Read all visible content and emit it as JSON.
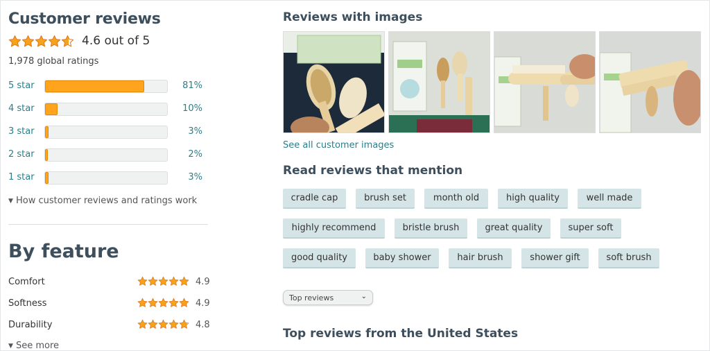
{
  "customer_reviews": {
    "title": "Customer reviews",
    "rating_value": 4.6,
    "average_text": "4.6 out of 5",
    "global_ratings": "1,978 global ratings",
    "histogram": [
      {
        "label": "5 star",
        "percent": 81,
        "percent_text": "81%"
      },
      {
        "label": "4 star",
        "percent": 10,
        "percent_text": "10%"
      },
      {
        "label": "3 star",
        "percent": 3,
        "percent_text": "3%"
      },
      {
        "label": "2 star",
        "percent": 2,
        "percent_text": "2%"
      },
      {
        "label": "1 star",
        "percent": 3,
        "percent_text": "3%"
      }
    ],
    "how_link": "How customer reviews and ratings work"
  },
  "by_feature": {
    "title": "By feature",
    "features": [
      {
        "name": "Comfort",
        "rating": 4.9,
        "rating_text": "4.9"
      },
      {
        "name": "Softness",
        "rating": 4.9,
        "rating_text": "4.9"
      },
      {
        "name": "Durability",
        "rating": 4.8,
        "rating_text": "4.8"
      }
    ],
    "see_more": "See more"
  },
  "reviews_with_images": {
    "title": "Reviews with images",
    "images": [
      {
        "alt_icon": "photo-icon"
      },
      {
        "alt_icon": "photo-icon"
      },
      {
        "alt_icon": "photo-icon"
      },
      {
        "alt_icon": "photo-icon"
      }
    ],
    "see_all": "See all customer images"
  },
  "mentions": {
    "title": "Read reviews that mention",
    "chips": [
      "cradle cap",
      "brush set",
      "month old",
      "high quality",
      "well made",
      "highly recommend",
      "bristle brush",
      "great quality",
      "super soft",
      "good quality",
      "baby shower",
      "hair brush",
      "shower gift",
      "soft brush"
    ]
  },
  "sort": {
    "selected": "Top reviews"
  },
  "top_reviews": {
    "title": "Top reviews from the United States"
  },
  "colors": {
    "star": "#f7a21b",
    "star_outline": "#de7921",
    "bar_fill": "#ffa41c",
    "link": "#2a7f8a",
    "heading": "#3d4e5c",
    "chip_bg": "#d5e4e6"
  }
}
